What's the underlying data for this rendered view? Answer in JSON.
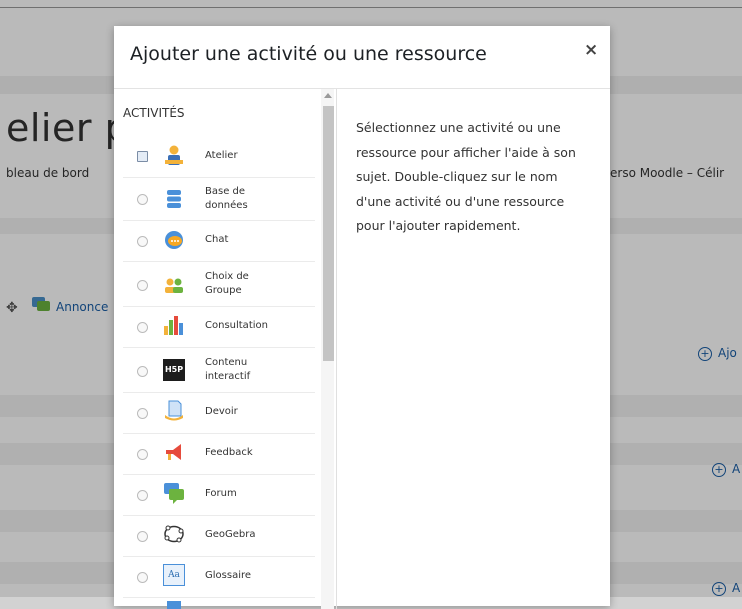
{
  "background": {
    "page_title": "elier pc",
    "breadcrumb_left": "bleau de bord",
    "breadcrumb_right": "erso Moodle – Célir",
    "announcement_link": "Annonce",
    "add_activity_1": "Ajo",
    "add_activity_2": "A",
    "add_activity_3": "A"
  },
  "modal": {
    "title": "Ajouter une activité ou une ressource",
    "close_symbol": "×",
    "activities_header": "ACTIVITÉS",
    "items": [
      {
        "label": "Atelier",
        "icon": "workshop-icon",
        "selected": true
      },
      {
        "label": "Base de\ndonnées",
        "icon": "database-icon",
        "selected": false
      },
      {
        "label": "Chat",
        "icon": "chat-icon",
        "selected": false
      },
      {
        "label": "Choix de\nGroupe",
        "icon": "group-choice-icon",
        "selected": false
      },
      {
        "label": "Consultation",
        "icon": "consultation-chart-icon",
        "selected": false
      },
      {
        "label": "Contenu\ninteractif",
        "icon": "h5p-icon",
        "selected": false
      },
      {
        "label": "Devoir",
        "icon": "assignment-icon",
        "selected": false
      },
      {
        "label": "Feedback",
        "icon": "megaphone-icon",
        "selected": false
      },
      {
        "label": "Forum",
        "icon": "forum-icon",
        "selected": false
      },
      {
        "label": "GeoGebra",
        "icon": "geogebra-icon",
        "selected": false
      },
      {
        "label": "Glossaire",
        "icon": "glossary-icon",
        "selected": false
      }
    ],
    "help_text": "Sélectionnez une activité ou une ressource pour afficher l'aide à son sujet. Double-cliquez sur le nom d'une activité ou d'une ressource pour l'ajouter rapidement.",
    "h5p_badge": "H5P",
    "glossary_badge": "Aa"
  },
  "colors": {
    "link": "#1a5ea6",
    "overlay": "rgba(0,0,0,0.27)"
  }
}
